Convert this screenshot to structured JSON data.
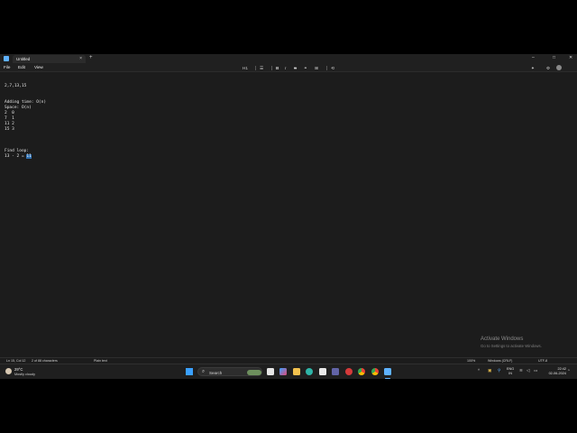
{
  "window": {
    "tab_title": "Untitled",
    "tab_close": "×",
    "new_tab": "+",
    "controls": {
      "minimize": "–",
      "maximize": "□",
      "close": "✕"
    }
  },
  "menu": {
    "file": "File",
    "edit": "Edit",
    "view": "View"
  },
  "toolbar": {
    "heading": "H1",
    "list": "☰",
    "bold": "B",
    "italic": "I",
    "strikethrough": "S",
    "link": "⚭",
    "table": "⊞",
    "clear_format": "⟲",
    "copilot": "✦",
    "settings": "⚙"
  },
  "editor": {
    "lines": [
      "2,7,13,15",
      "",
      "",
      "Adding time: O(n)",
      "Space: O(n)",
      "2  0",
      "7  1",
      "11 2",
      "15 3",
      "",
      "",
      "",
      "Find loop:",
      "13 - 2 = "
    ],
    "selected_text": "11"
  },
  "watermark": {
    "title": "Activate Windows",
    "subtitle": "Go to Settings to activate Windows."
  },
  "status": {
    "position": "Ln 15, Col 12",
    "selection": "2 of 88 characters",
    "format": "Plain text",
    "zoom": "100%",
    "line_ending": "Windows (CRLF)",
    "encoding": "UTF-8"
  },
  "taskbar": {
    "weather_temp": "29°C",
    "weather_desc": "Mostly cloudy",
    "search_placeholder": "Search",
    "tray_chevron": "^",
    "lang_line1": "ENG",
    "lang_line2": "IN",
    "time": "22:42",
    "date": "02-06-2024"
  },
  "colors": {
    "accent": "#3aa0ff",
    "selection": "#2f6fb0",
    "editor_bg": "#1c1c1c"
  }
}
